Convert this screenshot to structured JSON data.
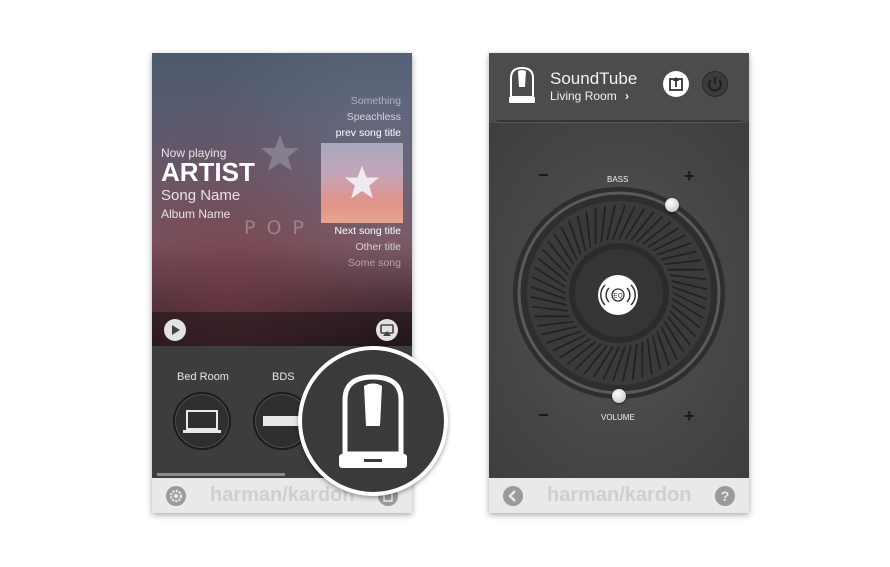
{
  "left_screen": {
    "now_playing": {
      "label": "Now playing",
      "artist": "ARTIST",
      "song": "Song Name",
      "album": "Album Name",
      "genre_watermark": "POP"
    },
    "tracklist": {
      "previous": [
        "Something",
        "Speachless",
        "prev song title"
      ],
      "next": [
        "Next song title",
        "Other title",
        "Some song"
      ]
    },
    "playback": {
      "play_icon": "play-icon",
      "airplay_icon": "airplay-icon"
    },
    "rooms": [
      {
        "label": "Bed Room",
        "icon": "laptop-icon"
      },
      {
        "label": "BDS",
        "icon": "soundbar-icon"
      }
    ],
    "footer": {
      "brand": "harman/kardon",
      "settings_icon": "gear-icon",
      "trash_icon": "trash-icon"
    },
    "highlight_icon": "aura-speaker-icon"
  },
  "right_screen": {
    "header": {
      "device_name": "SoundTube",
      "room_name": "Living Room",
      "chevron": "›",
      "device_icon": "aura-speaker-icon",
      "share_icon": "share-icon",
      "power_icon": "power-icon"
    },
    "controls": {
      "bass_label": "BASS",
      "volume_label": "VOLUME",
      "minus": "−",
      "plus": "+",
      "eq_label": "EQ",
      "bass_level": 0.72,
      "volume_level": 0.5
    },
    "footer": {
      "brand": "harman/kardon",
      "back_icon": "chevron-left-icon",
      "help_icon": "help-icon",
      "help_label": "?"
    }
  }
}
